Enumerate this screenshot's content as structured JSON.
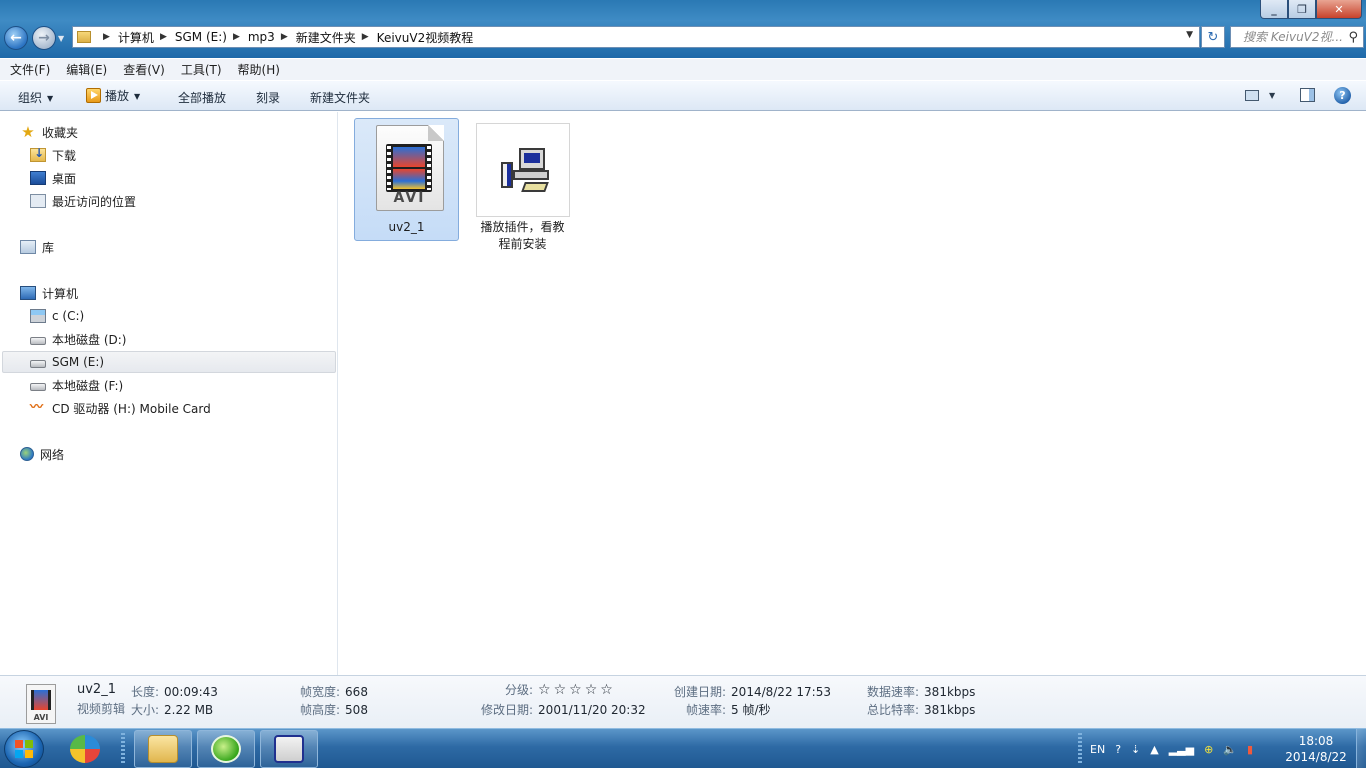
{
  "window": {
    "minimize_label": "_",
    "maximize_label": "❐",
    "close_label": "✕"
  },
  "address": {
    "crumbs": [
      "计算机",
      "SGM (E:)",
      "mp3",
      "新建文件夹",
      "KeivuV2视频教程"
    ]
  },
  "search": {
    "placeholder": "搜索 KeivuV2视..."
  },
  "menu": {
    "items": [
      "文件(F)",
      "编辑(E)",
      "查看(V)",
      "工具(T)",
      "帮助(H)"
    ]
  },
  "toolbar": {
    "organize": "组织",
    "play": "播放",
    "play_all": "全部播放",
    "burn": "刻录",
    "new_folder": "新建文件夹",
    "help": "?"
  },
  "nav": {
    "favorites": "收藏夹",
    "downloads": "下载",
    "desktop": "桌面",
    "recent": "最近访问的位置",
    "library": "库",
    "computer": "计算机",
    "drive_c": "c (C:)",
    "drive_d": "本地磁盘 (D:)",
    "drive_e": "SGM (E:)",
    "drive_f": "本地磁盘 (F:)",
    "drive_h": "CD 驱动器 (H:) Mobile Card",
    "network": "网络"
  },
  "files": [
    {
      "name": "uv2_1",
      "type_badge": "AVI",
      "selected": true
    },
    {
      "name": "播放插件，看教程前安装",
      "selected": false
    }
  ],
  "details": {
    "name": "uv2_1",
    "type": "视频剪辑",
    "icon_badge": "AVI",
    "length_label": "长度:",
    "length": "00:09:43",
    "size_label": "大小:",
    "size": "2.22 MB",
    "frame_width_label": "帧宽度:",
    "frame_width": "668",
    "frame_height_label": "帧高度:",
    "frame_height": "508",
    "rating_label": "分级:",
    "rating_stars": "☆☆☆☆☆",
    "modified_label": "修改日期:",
    "modified": "2001/11/20 20:32",
    "created_label": "创建日期:",
    "created": "2014/8/22 17:53",
    "frame_rate_label": "帧速率:",
    "frame_rate": "5 帧/秒",
    "data_rate_label": "数据速率:",
    "data_rate": "381kbps",
    "total_bitrate_label": "总比特率:",
    "total_bitrate": "381kbps"
  },
  "tray": {
    "lang": "EN",
    "time": "18:08",
    "date": "2014/8/22"
  },
  "colors": {
    "titlebar": "#2a79b4",
    "selection": "#c5dcf7",
    "taskbar": "#2e6aa5"
  }
}
